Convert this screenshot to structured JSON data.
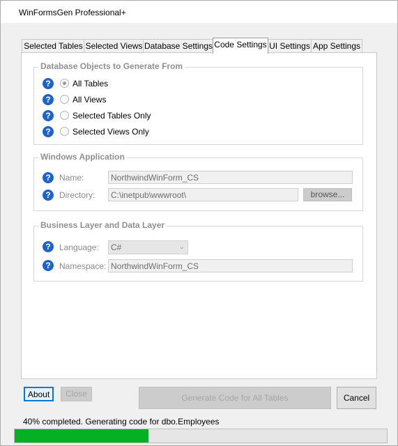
{
  "window": {
    "title": "WinFormsGen Professional+"
  },
  "tabs": [
    {
      "label": "Selected Tables"
    },
    {
      "label": "Selected Views"
    },
    {
      "label": "Database Settings"
    },
    {
      "label": "Code Settings",
      "active": true
    },
    {
      "label": "UI Settings"
    },
    {
      "label": "App Settings"
    }
  ],
  "db_objects": {
    "title": "Database Objects to Generate From",
    "options": [
      {
        "label": "All Tables",
        "checked": true
      },
      {
        "label": "All Views",
        "checked": false
      },
      {
        "label": "Selected Tables Only",
        "checked": false
      },
      {
        "label": "Selected Views Only",
        "checked": false
      }
    ]
  },
  "windows_app": {
    "title": "Windows Application",
    "name_label": "Name:",
    "name_value": "NorthwindWinForm_CS",
    "directory_label": "Directory:",
    "directory_value": "C:\\inetpub\\wwwroot\\",
    "browse_label": "browse..."
  },
  "business_layer": {
    "title": "Business Layer and Data Layer",
    "language_label": "Language:",
    "language_value": "C#",
    "namespace_label": "Namespace:",
    "namespace_value": "NorthwindWinForm_CS"
  },
  "buttons": {
    "about": "About",
    "close": "Close",
    "generate": "Generate Code for All Tables",
    "cancel": "Cancel"
  },
  "status": {
    "text": "40% completed.  Generating code for dbo.Employees",
    "progress": 0.36
  },
  "colors": {
    "help_icon": "#1c64c8",
    "progress_fill": "#06b025"
  }
}
